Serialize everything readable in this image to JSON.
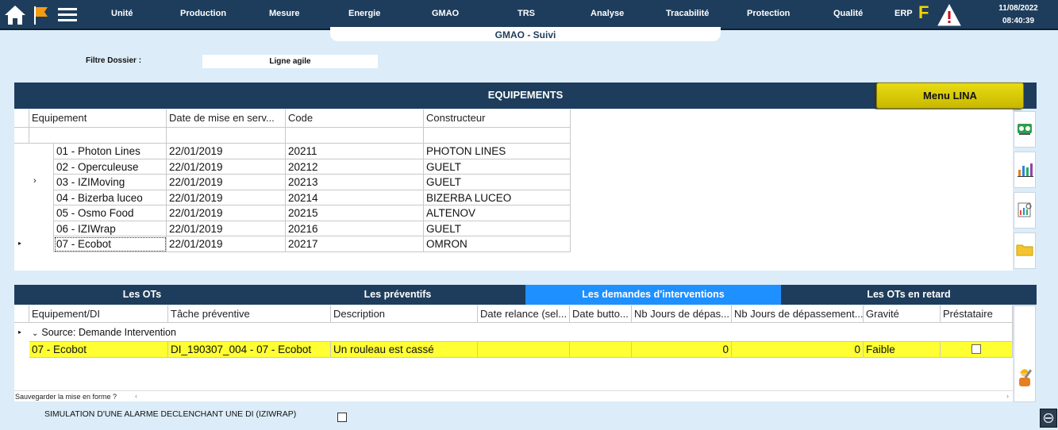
{
  "nav": {
    "items": [
      "Unité",
      "Production",
      "Mesure",
      "Energie",
      "GMAO",
      "TRS",
      "Analyse",
      "Tracabilité",
      "Protection",
      "Qualité"
    ],
    "erp": "ERP",
    "f_letter": "F",
    "date": "11/08/2022",
    "time": "08:40:39",
    "icons": [
      "home-icon",
      "flag-icon",
      "hamburger-menu-icon",
      "alert-icon"
    ]
  },
  "page_title": "GMAO - Suivi",
  "filter": {
    "label": "Filtre Dossier :",
    "value": "Ligne agile"
  },
  "equipements": {
    "title": "EQUIPEMENTS",
    "menu_button": "Menu LINA",
    "columns": [
      "Equipement",
      "Date de mise en serv...",
      "Code",
      "Constructeur"
    ],
    "rows": [
      {
        "equip": "01 - Photon Lines",
        "date": "22/01/2019",
        "code": "20211",
        "constructeur": "PHOTON LINES"
      },
      {
        "equip": "02 - Operculeuse",
        "date": "22/01/2019",
        "code": "20212",
        "constructeur": "GUELT"
      },
      {
        "equip": "03 - IZIMoving",
        "date": "22/01/2019",
        "code": "20213",
        "constructeur": "GUELT"
      },
      {
        "equip": "04 - Bizerba luceo",
        "date": "22/01/2019",
        "code": "20214",
        "constructeur": "BIZERBA LUCEO"
      },
      {
        "equip": "05 - Osmo Food",
        "date": "22/01/2019",
        "code": "20215",
        "constructeur": "ALTENOV"
      },
      {
        "equip": "06 - IZIWrap",
        "date": "22/01/2019",
        "code": "20216",
        "constructeur": "GUELT"
      },
      {
        "equip": "07 - Ecobot",
        "date": "22/01/2019",
        "code": "20217",
        "constructeur": "OMRON"
      }
    ],
    "side_icons": [
      "machine-icon",
      "bar-chart-icon",
      "report-icon",
      "folder-icon"
    ]
  },
  "tabs": [
    "Les OTs",
    "Les préventifs",
    "Les demandes d'interventions",
    "Les OTs en retard"
  ],
  "active_tab": 2,
  "interventions": {
    "columns": [
      "Equipement/DI",
      "Tâche préventive",
      "Description",
      "Date relance (sel...",
      "Date butto...",
      "Nb Jours de dépas...",
      "Nb Jours de dépassement...",
      "Gravité",
      "Préstataire"
    ],
    "group_label": "Source: Demande Intervention",
    "row": {
      "equip": "07 - Ecobot",
      "tache": "DI_190307_004 - 07 - Ecobot",
      "description": "Un rouleau est cassé",
      "date_relance": "",
      "date_butoir": "",
      "nb_jours_1": "0",
      "nb_jours_2": "0",
      "gravite": "Faible"
    }
  },
  "save_hint": "Sauvegarder la mise en forme ?",
  "simulation_label": "SIMULATION D'UNE ALARME DECLENCHANT UNE DI (IZIWRAP)",
  "colors": {
    "nav_bg": "#1e3d5c",
    "accent_blue": "#1e90ff",
    "highlight_yellow": "#ffff33",
    "menu_lina": "#d8cc00"
  }
}
